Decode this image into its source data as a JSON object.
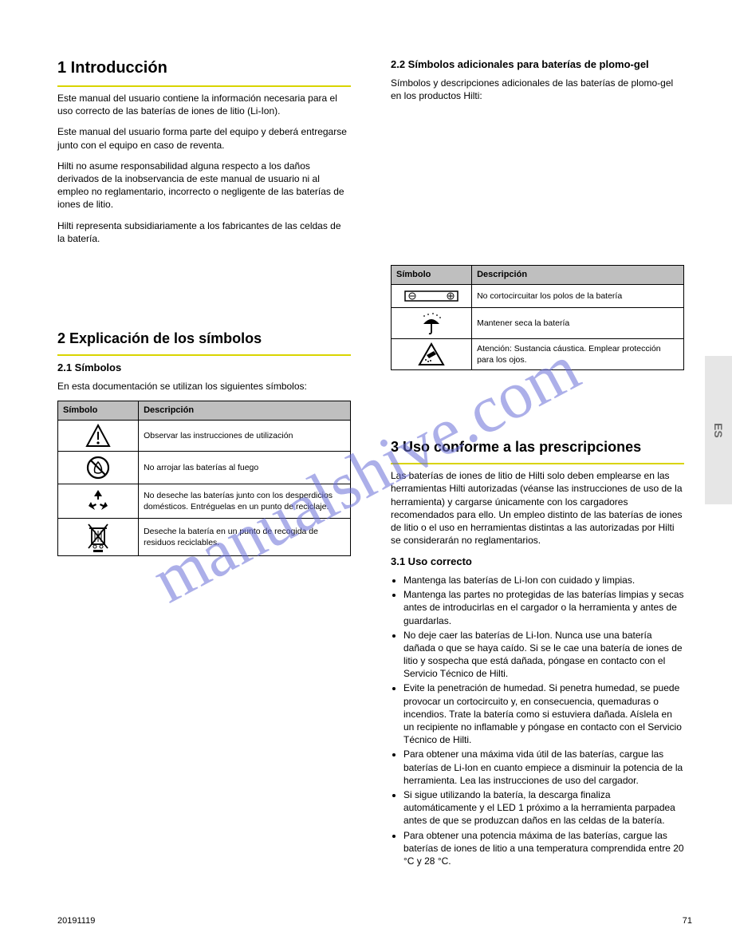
{
  "watermark": "manualshive.com",
  "side_tab": "ES",
  "footer": {
    "left": "20191119",
    "right": "71"
  },
  "section1": {
    "title": "1  Introducción",
    "paras": [
      "Este manual del usuario contiene la información necesaria para el uso correcto de las baterías de iones de litio (Li-Ion).",
      "Este manual del usuario forma parte del equipo y deberá entregarse junto con el equipo en caso de reventa.",
      "Hilti no asume responsabilidad alguna respecto a los daños derivados de la inobservancia de este manual de usuario ni al empleo no reglamentario, incorrecto o negligente de las baterías de iones de litio.",
      "Hilti representa subsidiariamente a los fabricantes de las celdas de la batería."
    ]
  },
  "section2": {
    "title": "2  Explicación de los símbolos",
    "sub1_title": "2.1  Símbolos",
    "sub1_intro": "En esta documentación se utilizan los siguientes símbolos:",
    "table1_headers": {
      "sym": "Símbolo",
      "desc": "Descripción"
    },
    "table1_rows": [
      {
        "desc": "Observar las instrucciones de utilización"
      },
      {
        "desc": "No arrojar las baterías al fuego"
      },
      {
        "desc": "No deseche las baterías junto con los desperdicios domésticos. Entréguelas en un punto de reciclaje."
      },
      {
        "desc": "Deseche la batería en un punto de recogida de residuos reciclables."
      }
    ],
    "sub2_title": "2.2  Símbolos adicionales para baterías de plomo-gel",
    "sub2_intro": "Símbolos y descripciones adicionales de las baterías de plomo-gel en los productos Hilti:",
    "table2_headers": {
      "sym": "Símbolo",
      "desc": "Descripción"
    },
    "table2_rows": [
      {
        "desc": "No cortocircuitar los polos de la batería"
      },
      {
        "desc": "Mantener seca la batería"
      },
      {
        "desc": "Atención: Sustancia cáustica. Emplear protección para los ojos."
      }
    ]
  },
  "section3": {
    "title": "3  Uso conforme a las prescripciones",
    "para": "Las baterías de iones de litio de Hilti solo deben emplearse en las herramientas Hilti autorizadas (véanse las instrucciones de uso de la herramienta) y cargarse únicamente con los cargadores recomendados para ello. Un empleo distinto de las baterías de iones de litio o el uso en herramientas distintas a las autorizadas por Hilti se considerarán no reglamentarios.",
    "sub_title": "3.1  Uso correcto",
    "bullets": [
      "Mantenga las baterías de Li-Ion con cuidado y limpias.",
      "Mantenga las partes no protegidas de las baterías limpias y secas antes de introducirlas en el cargador o la herramienta y antes de guardarlas.",
      "No deje caer las baterías de Li-Ion. Nunca use una batería dañada o que se haya caído. Si se le cae una batería de iones de litio y sospecha que está dañada, póngase en contacto con el Servicio Técnico de Hilti.",
      "Evite la penetración de humedad. Si penetra humedad, se puede provocar un cortocircuito y, en consecuencia, quemaduras o incendios. Trate la batería como si estuviera dañada. Aíslela en un recipiente no inflamable y póngase en contacto con el Servicio Técnico de Hilti.",
      "Para obtener una máxima vida útil de las baterías, cargue las baterías de Li-Ion en cuanto empiece a disminuir la potencia de la herramienta. Lea las instrucciones de uso del cargador.",
      "Si sigue utilizando la batería, la descarga finaliza automáticamente y el LED 1 próximo a la herramienta parpadea antes de que se produzcan daños en las celdas de la batería.",
      "Para obtener una potencia máxima de las baterías, cargue las baterías de iones de litio a una temperatura comprendida entre 20 °C y 28 °C."
    ]
  }
}
